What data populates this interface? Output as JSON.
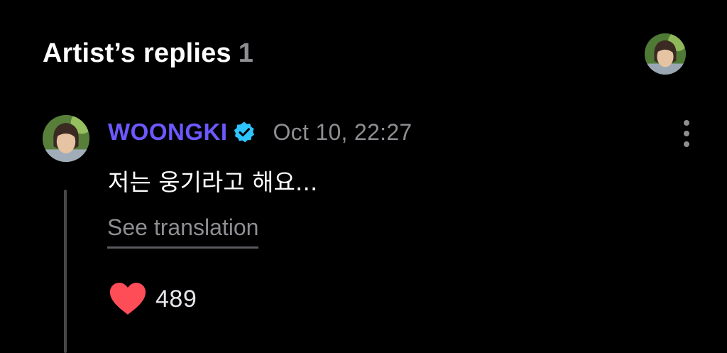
{
  "header": {
    "title": "Artist’s replies",
    "count": "1"
  },
  "reply": {
    "author": "WOONGKI",
    "timestamp": "Oct 10, 22:27",
    "message": "저는 웅기라고 해요...",
    "translate_label": "See translation",
    "likes": "489"
  },
  "icons": {
    "verified": "verified-badge-icon",
    "more": "more-vertical-icon",
    "like": "heart-icon"
  },
  "colors": {
    "background": "#000000",
    "author_name": "#6b59ff",
    "verified_badge": "#2ec4ff",
    "heart": "#ff4d57",
    "muted_text": "#8e8e93"
  }
}
